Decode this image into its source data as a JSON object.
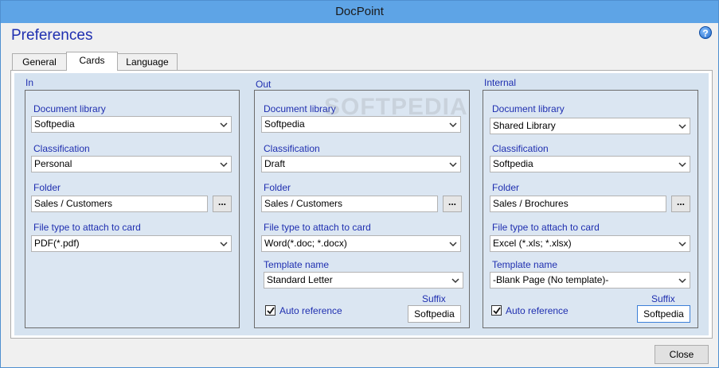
{
  "window": {
    "title": "DocPoint"
  },
  "header": {
    "title": "Preferences",
    "help_icon": "?"
  },
  "tabs": [
    {
      "label": "General"
    },
    {
      "label": "Cards",
      "active": true
    },
    {
      "label": "Language"
    }
  ],
  "labels": {
    "document_library": "Document library",
    "classification": "Classification",
    "folder": "Folder",
    "file_type": "File type to attach to card",
    "template_name": "Template name",
    "suffix": "Suffix",
    "auto_reference": "Auto reference",
    "browse": "..."
  },
  "groups": {
    "in": {
      "title": "In",
      "document_library": "Softpedia",
      "classification": "Personal",
      "folder": "Sales / Customers",
      "file_type": "PDF(*.pdf)"
    },
    "out": {
      "title": "Out",
      "document_library": "Softpedia",
      "classification": "Draft",
      "folder": "Sales / Customers",
      "file_type": "Word(*.doc; *.docx)",
      "template_name": "Standard Letter",
      "auto_reference": true,
      "suffix": "Softpedia"
    },
    "internal": {
      "title": "Internal",
      "document_library": "Shared Library",
      "classification": "Softpedia",
      "folder": "Sales / Brochures",
      "file_type": "Excel (*.xls; *.xlsx)",
      "template_name": "-Blank Page  (No template)-",
      "auto_reference": true,
      "suffix": "Softpedia"
    }
  },
  "footer": {
    "close_label": "Close"
  },
  "watermark": "SOFTPEDIA",
  "colors": {
    "label_blue": "#1f2fb0",
    "titlebar": "#5ea4e6",
    "panel_bg": "#d6e3f0"
  }
}
